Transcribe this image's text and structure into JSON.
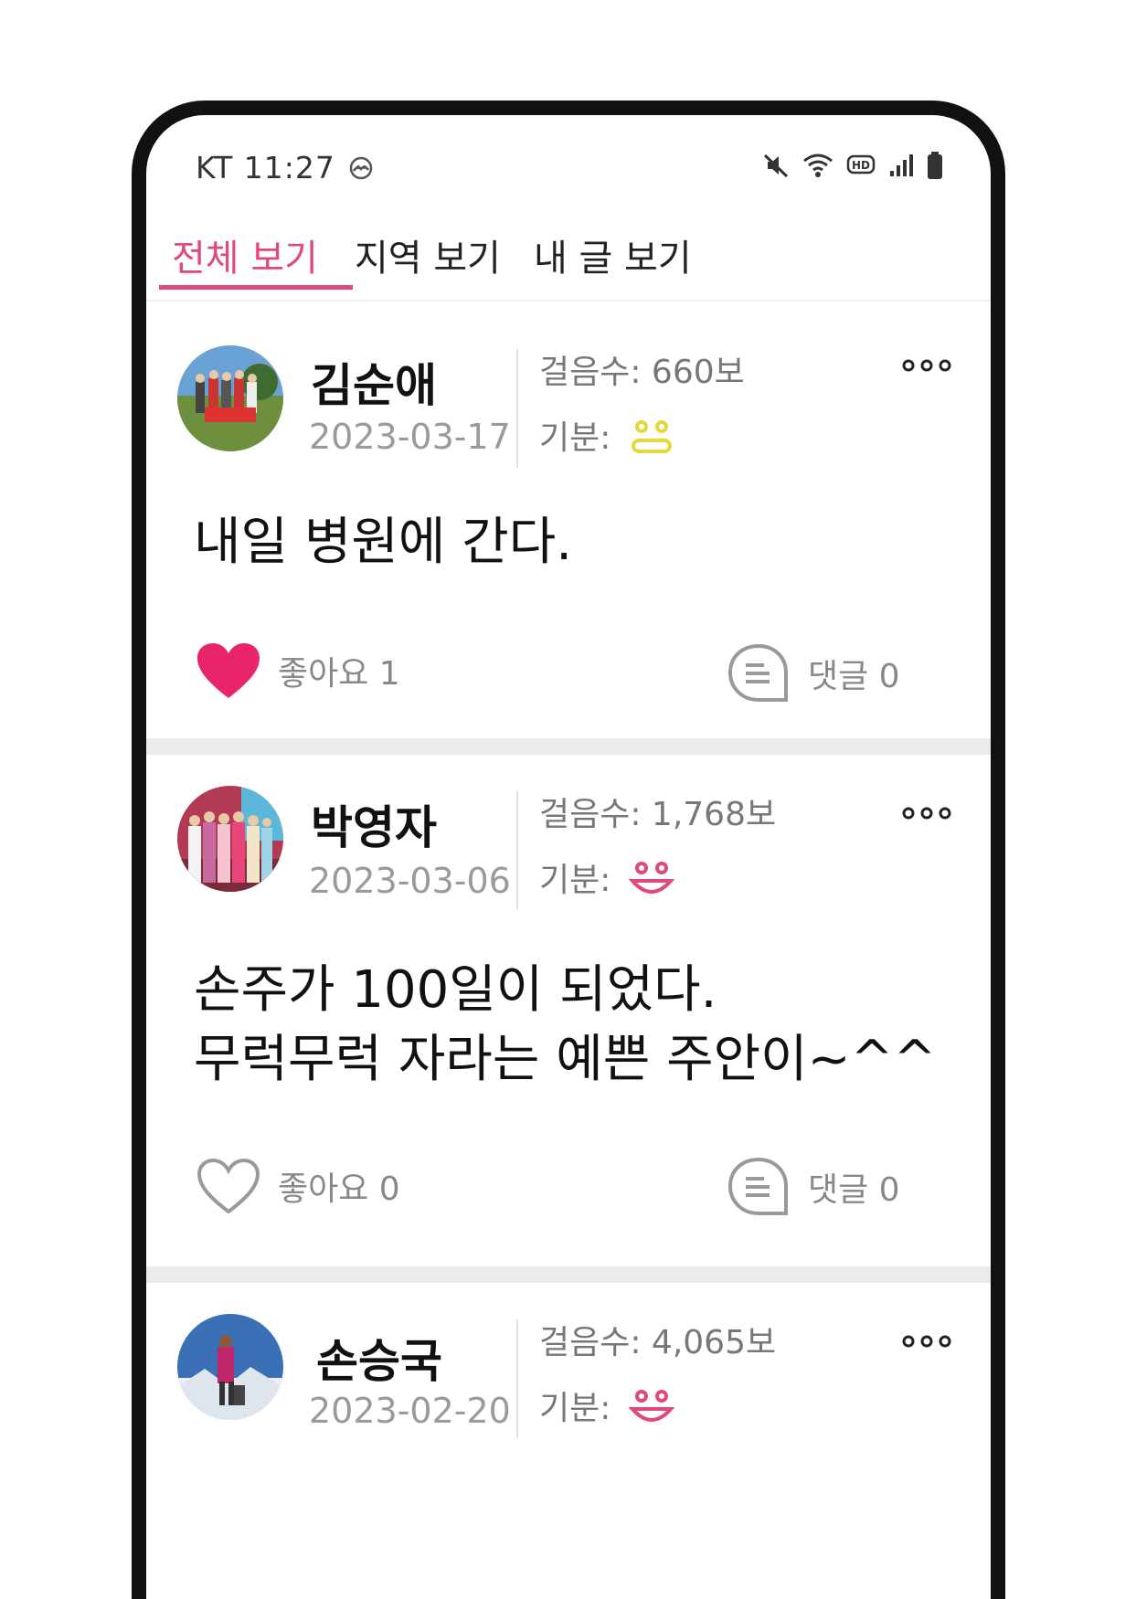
{
  "status_bar": {
    "carrier_time": "KT 11:27",
    "icons": [
      "weather-icon",
      "mute-icon",
      "wifi-icon",
      "hd-icon",
      "signal-icon",
      "battery-icon"
    ]
  },
  "tabs": [
    {
      "label": "전체 보기",
      "active": true
    },
    {
      "label": "지역 보기",
      "active": false
    },
    {
      "label": "내 글 보기",
      "active": false
    }
  ],
  "accent_color": "#e04a7a",
  "posts": [
    {
      "name": "김순애",
      "date": "2023-03-17",
      "steps": "걸음수: 660보",
      "mood_label": "기분:",
      "mood_icon": "neutral-face-icon",
      "mood_color": "#e3d83a",
      "content": "내일 병원에 간다.",
      "likes": "좋아요 1",
      "liked": true,
      "comments": "댓글 0"
    },
    {
      "name": "박영자",
      "date": "2023-03-06",
      "steps": "걸음수: 1,768보",
      "mood_label": "기분:",
      "mood_icon": "happy-face-icon",
      "mood_color": "#e04a7a",
      "content": "손주가 100일이 되었다.\n무럭무럭 자라는 예쁜 주안이~^^",
      "likes": "좋아요 0",
      "liked": false,
      "comments": "댓글 0"
    },
    {
      "name": "손승국",
      "date": "2023-02-20",
      "steps": "걸음수: 4,065보",
      "mood_label": "기분:",
      "mood_icon": "happy-face-icon",
      "mood_color": "#e04a7a"
    }
  ]
}
